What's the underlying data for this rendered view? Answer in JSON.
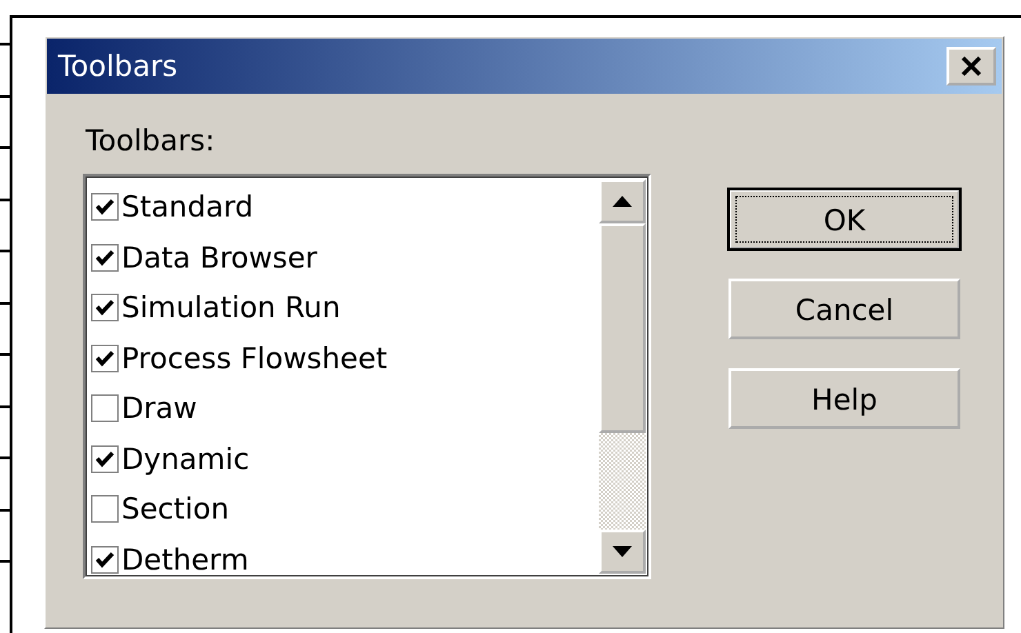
{
  "window": {
    "title": "Toolbars"
  },
  "list_label": "Toolbars:",
  "toolbars": [
    {
      "label": "Standard",
      "checked": true
    },
    {
      "label": "Data Browser",
      "checked": true
    },
    {
      "label": "Simulation Run",
      "checked": true
    },
    {
      "label": "Process Flowsheet",
      "checked": true
    },
    {
      "label": "Draw",
      "checked": false
    },
    {
      "label": "Dynamic",
      "checked": true
    },
    {
      "label": "Section",
      "checked": false
    },
    {
      "label": "Detherm",
      "checked": true
    }
  ],
  "buttons": [
    {
      "label": "OK",
      "default": true
    },
    {
      "label": "Cancel",
      "default": false
    },
    {
      "label": "Help",
      "default": false
    }
  ]
}
